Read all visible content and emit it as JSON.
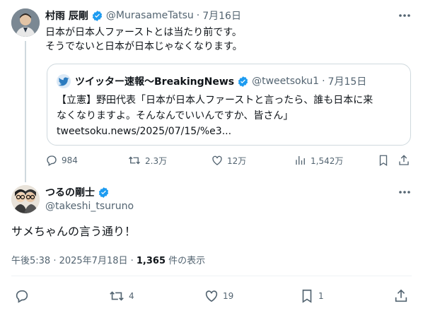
{
  "tweet": {
    "name": "村雨 辰剛",
    "handle": "@MurasameTatsu",
    "separator": "·",
    "date": "7月16日",
    "line1": "日本が日本人ファーストとは当たり前です。",
    "line2": "そうでないと日本が日本じゃなくなります。",
    "quote": {
      "name": "ツイッター速報〜BreakingNews",
      "handle": "@tweetsoku1",
      "separator": "·",
      "date": "7月15日",
      "line1": "【立憲】野田代表「日本が日本人ファーストと言ったら、誰も日本に来",
      "line2": "なくなりますよ。そんなんでいいんですか、皆さん」",
      "link": "tweetsoku.news/2025/07/15/%e3..."
    },
    "stats": {
      "replies": "984",
      "retweets": "2.3万",
      "likes": "12万",
      "views": "1,542万"
    }
  },
  "reply": {
    "name": "つるの剛士",
    "handle": "@takeshi_tsuruno",
    "text": "サメちゃんの言う通り！",
    "time": "午後5:38 · 2025年7月18日 · ",
    "views_count": "1,365",
    "views_label": " 件の表示",
    "stats": {
      "retweets": "4",
      "likes": "19",
      "bookmarks": "1"
    }
  },
  "colors": {
    "verified": "#1d9bf0",
    "text": "#0f1419",
    "muted": "#536471",
    "border": "#cfd9de"
  }
}
